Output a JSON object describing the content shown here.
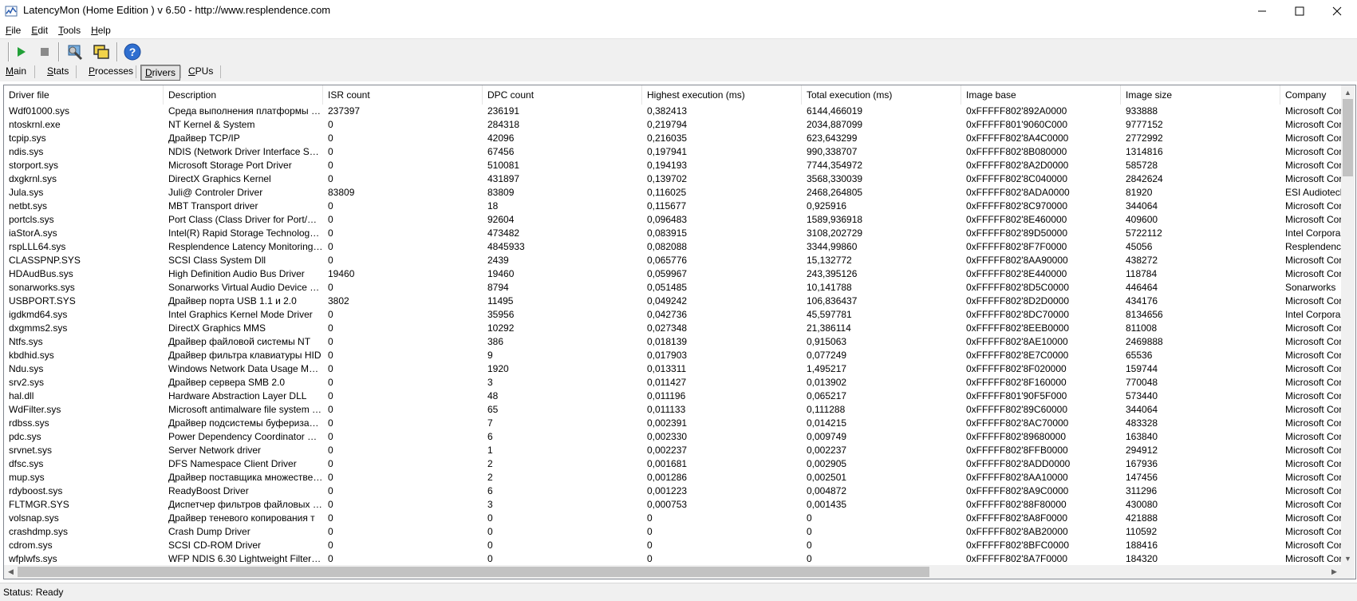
{
  "window": {
    "title": "LatencyMon  (Home Edition )  v 6.50 - http://www.resplendence.com"
  },
  "menu": [
    {
      "label": "File"
    },
    {
      "label": "Edit"
    },
    {
      "label": "Tools"
    },
    {
      "label": "Help"
    }
  ],
  "toolbar": {
    "icons": [
      "play-icon",
      "stop-icon",
      "driver-properties-icon",
      "windows-icon",
      "help-icon"
    ]
  },
  "tabs": [
    {
      "label": "Main"
    },
    {
      "label": "Stats"
    },
    {
      "label": "Processes"
    },
    {
      "label": "Drivers"
    },
    {
      "label": "CPUs"
    }
  ],
  "active_tab": "Drivers",
  "table": {
    "columns": [
      "Driver file",
      "Description",
      "ISR count",
      "DPC count",
      "Highest execution (ms)",
      "Total execution (ms)",
      "Image base",
      "Image size",
      "Company"
    ],
    "rows": [
      [
        "Wdf01000.sys",
        "Среда выполнения платформы др...",
        "237397",
        "236191",
        "0,382413",
        "6144,466019",
        "0xFFFFF802'892A0000",
        "933888",
        "Microsoft Cor"
      ],
      [
        "ntoskrnl.exe",
        "NT Kernel & System",
        "0",
        "284318",
        "0,219794",
        "2034,887099",
        "0xFFFFF801'9060C000",
        "9777152",
        "Microsoft Cor"
      ],
      [
        "tcpip.sys",
        "Драйвер TCP/IP",
        "0",
        "42096",
        "0,216035",
        "623,643299",
        "0xFFFFF802'8A4C0000",
        "2772992",
        "Microsoft Cor"
      ],
      [
        "ndis.sys",
        "NDIS (Network Driver Interface Spe...",
        "0",
        "67456",
        "0,197941",
        "990,338707",
        "0xFFFFF802'8B080000",
        "1314816",
        "Microsoft Cor"
      ],
      [
        "storport.sys",
        "Microsoft Storage Port Driver",
        "0",
        "510081",
        "0,194193",
        "7744,354972",
        "0xFFFFF802'8A2D0000",
        "585728",
        "Microsoft Cor"
      ],
      [
        "dxgkrnl.sys",
        "DirectX Graphics Kernel",
        "0",
        "431897",
        "0,139702",
        "3568,330039",
        "0xFFFFF802'8C040000",
        "2842624",
        "Microsoft Cor"
      ],
      [
        "Jula.sys",
        "Juli@ Controler Driver",
        "83809",
        "83809",
        "0,116025",
        "2468,264805",
        "0xFFFFF802'8ADA0000",
        "81920",
        "ESI Audiotech"
      ],
      [
        "netbt.sys",
        "MBT Transport driver",
        "0",
        "18",
        "0,115677",
        "0,925916",
        "0xFFFFF802'8C970000",
        "344064",
        "Microsoft Cor"
      ],
      [
        "portcls.sys",
        "Port Class (Class Driver for Port/Mini...",
        "0",
        "92604",
        "0,096483",
        "1589,936918",
        "0xFFFFF802'8E460000",
        "409600",
        "Microsoft Cor"
      ],
      [
        "iaStorA.sys",
        "Intel(R) Rapid Storage Technology ...",
        "0",
        "473482",
        "0,083915",
        "3108,202729",
        "0xFFFFF802'89D50000",
        "5722112",
        "Intel Corpora"
      ],
      [
        "rspLLL64.sys",
        "Resplendence Latency Monitoring a...",
        "0",
        "4845933",
        "0,082088",
        "3344,99860",
        "0xFFFFF802'8F7F0000",
        "45056",
        "Resplendence"
      ],
      [
        "CLASSPNP.SYS",
        "SCSI Class System Dll",
        "0",
        "2439",
        "0,065776",
        "15,132772",
        "0xFFFFF802'8AA90000",
        "438272",
        "Microsoft Cor"
      ],
      [
        "HDAudBus.sys",
        "High Definition Audio Bus Driver",
        "19460",
        "19460",
        "0,059967",
        "243,395126",
        "0xFFFFF802'8E440000",
        "118784",
        "Microsoft Cor"
      ],
      [
        "sonarworks.sys",
        "Sonarworks Virtual Audio Device Driver",
        "0",
        "8794",
        "0,051485",
        "10,141788",
        "0xFFFFF802'8D5C0000",
        "446464",
        "Sonarworks"
      ],
      [
        "USBPORT.SYS",
        "Драйвер порта USB 1.1 и 2.0",
        "3802",
        "11495",
        "0,049242",
        "106,836437",
        "0xFFFFF802'8D2D0000",
        "434176",
        "Microsoft Cor"
      ],
      [
        "igdkmd64.sys",
        "Intel Graphics Kernel Mode Driver",
        "0",
        "35956",
        "0,042736",
        "45,597781",
        "0xFFFFF802'8DC70000",
        "8134656",
        "Intel Corpora"
      ],
      [
        "dxgmms2.sys",
        "DirectX Graphics MMS",
        "0",
        "10292",
        "0,027348",
        "21,386114",
        "0xFFFFF802'8EEB0000",
        "811008",
        "Microsoft Cor"
      ],
      [
        "Ntfs.sys",
        "Драйвер файловой системы NT",
        "0",
        "386",
        "0,018139",
        "0,915063",
        "0xFFFFF802'8AE10000",
        "2469888",
        "Microsoft Cor"
      ],
      [
        "kbdhid.sys",
        "Драйвер фильтра клавиатуры HID",
        "0",
        "9",
        "0,017903",
        "0,077249",
        "0xFFFFF802'8E7C0000",
        "65536",
        "Microsoft Cor"
      ],
      [
        "Ndu.sys",
        "Windows Network Data Usage Monit...",
        "0",
        "1920",
        "0,013311",
        "1,495217",
        "0xFFFFF802'8F020000",
        "159744",
        "Microsoft Cor"
      ],
      [
        "srv2.sys",
        "Драйвер сервера SMB 2.0",
        "0",
        "3",
        "0,011427",
        "0,013902",
        "0xFFFFF802'8F160000",
        "770048",
        "Microsoft Cor"
      ],
      [
        "hal.dll",
        "Hardware Abstraction Layer DLL",
        "0",
        "48",
        "0,011196",
        "0,065217",
        "0xFFFFF801'90F5F000",
        "573440",
        "Microsoft Cor"
      ],
      [
        "WdFilter.sys",
        "Microsoft antimalware file system filt...",
        "0",
        "65",
        "0,011133",
        "0,111288",
        "0xFFFFF802'89C60000",
        "344064",
        "Microsoft Cor"
      ],
      [
        "rdbss.sys",
        "Драйвер подсистемы буферизаци...",
        "0",
        "7",
        "0,002391",
        "0,014215",
        "0xFFFFF802'8AC70000",
        "483328",
        "Microsoft Cor"
      ],
      [
        "pdc.sys",
        "Power Dependency Coordinator Driver",
        "0",
        "6",
        "0,002330",
        "0,009749",
        "0xFFFFF802'89680000",
        "163840",
        "Microsoft Cor"
      ],
      [
        "srvnet.sys",
        "Server Network driver",
        "0",
        "1",
        "0,002237",
        "0,002237",
        "0xFFFFF802'8FFB0000",
        "294912",
        "Microsoft Cor"
      ],
      [
        "dfsc.sys",
        "DFS Namespace Client Driver",
        "0",
        "2",
        "0,001681",
        "0,002905",
        "0xFFFFF802'8ADD0000",
        "167936",
        "Microsoft Cor"
      ],
      [
        "mup.sys",
        "Драйвер поставщика множествен...",
        "0",
        "2",
        "0,001286",
        "0,002501",
        "0xFFFFF802'8AA10000",
        "147456",
        "Microsoft Cor"
      ],
      [
        "rdyboost.sys",
        "ReadyBoost Driver",
        "0",
        "6",
        "0,001223",
        "0,004872",
        "0xFFFFF802'8A9C0000",
        "311296",
        "Microsoft Cor"
      ],
      [
        "FLTMGR.SYS",
        "Диспетчер фильтров файловых с...",
        "0",
        "3",
        "0,000753",
        "0,001435",
        "0xFFFFF802'88F80000",
        "430080",
        "Microsoft Cor"
      ],
      [
        "volsnap.sys",
        "Драйвер теневого копирования т",
        "0",
        "0",
        "0",
        "0",
        "0xFFFFF802'8A8F0000",
        "421888",
        "Microsoft Cor"
      ],
      [
        "crashdmp.sys",
        "Crash Dump Driver",
        "0",
        "0",
        "0",
        "0",
        "0xFFFFF802'8AB20000",
        "110592",
        "Microsoft Cor"
      ],
      [
        "cdrom.sys",
        "SCSI CD-ROM Driver",
        "0",
        "0",
        "0",
        "0",
        "0xFFFFF802'8BFC0000",
        "188416",
        "Microsoft Cor"
      ],
      [
        "wfplwfs.sys",
        "WFP NDIS 6.30 Lightweight Filter Dr...",
        "0",
        "0",
        "0",
        "0",
        "0xFFFFF802'8A7F0000",
        "184320",
        "Microsoft Cor"
      ]
    ]
  },
  "status": {
    "text": "Status: Ready"
  }
}
